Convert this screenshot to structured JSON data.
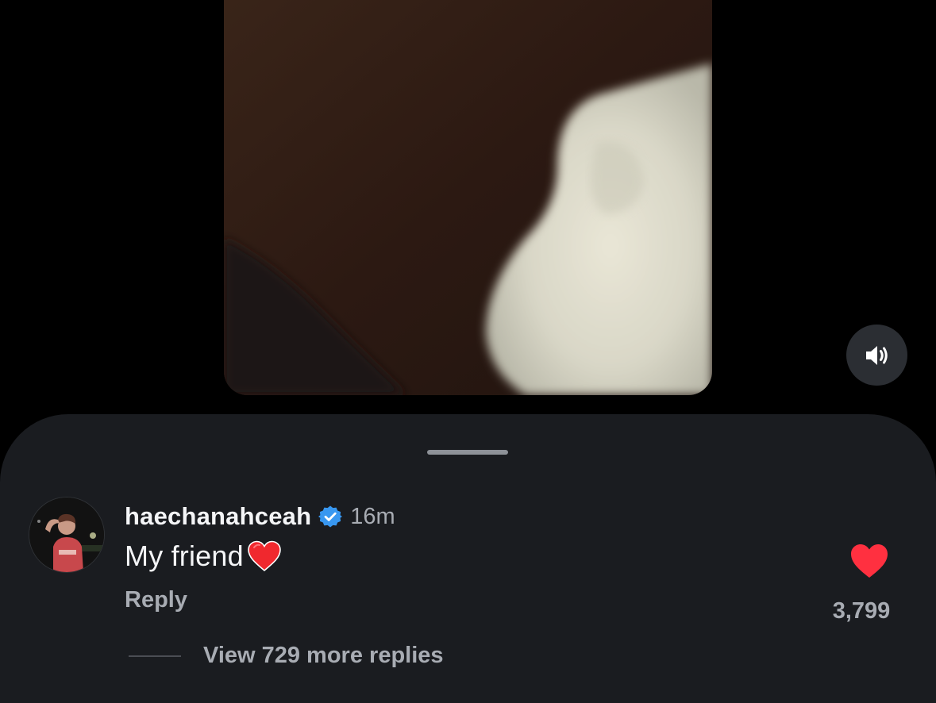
{
  "video": {
    "icon": "video-preview"
  },
  "sound_button": {
    "icon": "speaker-on-icon"
  },
  "comment": {
    "username": "haechanahceah",
    "verified_icon": "verified-badge-icon",
    "timestamp": "16m",
    "text": "My friend",
    "emoji": "red-heart-emoji",
    "reply_label": "Reply",
    "like_icon": "heart-filled-icon",
    "like_count": "3,799",
    "view_replies_label": "View 729 more replies"
  },
  "colors": {
    "background": "#000000",
    "sheet": "#1a1c20",
    "text_primary": "#f4f5f7",
    "text_secondary": "#a8acb3",
    "verified": "#3897f0",
    "like": "#ff3040"
  }
}
